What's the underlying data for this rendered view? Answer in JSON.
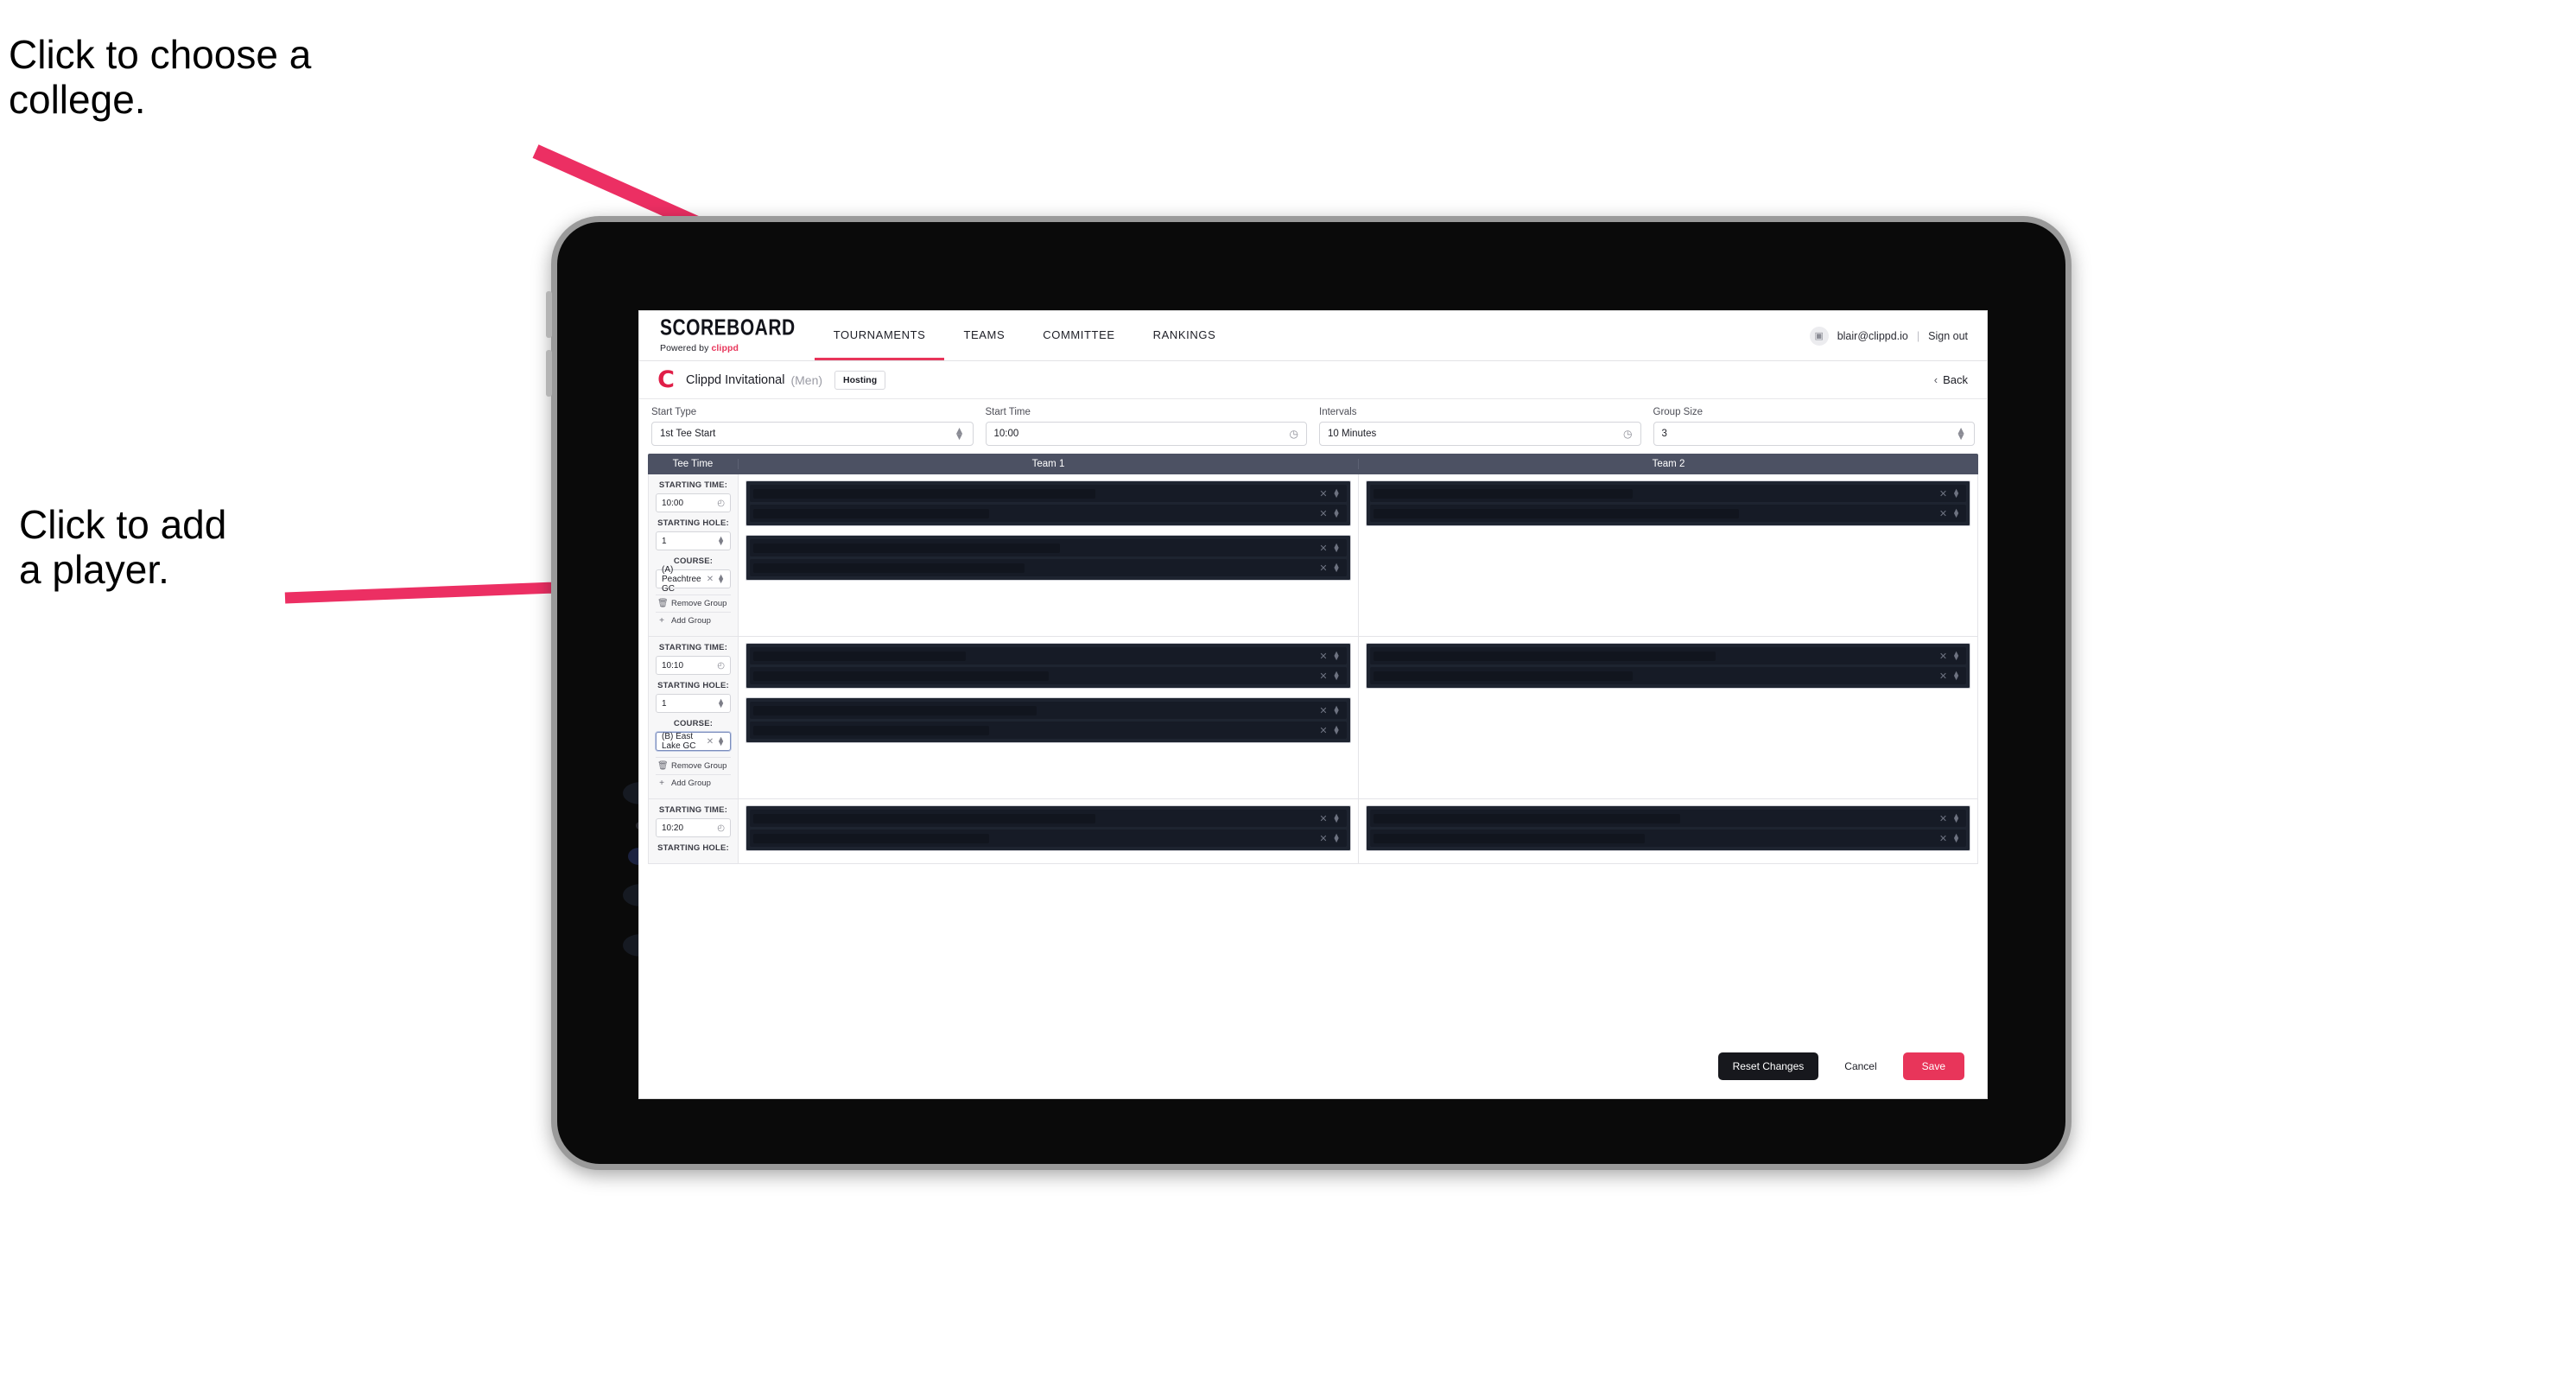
{
  "annotations": {
    "choose_college": "Click to choose a\ncollege.",
    "add_player": "Click to add\na player."
  },
  "colors": {
    "accent_pink": "#e8355a",
    "annotation_arrow": "#ec2f63",
    "table_header": "#4c5163",
    "player_block": "#1e2430",
    "dark_button": "#17181d"
  },
  "navbar": {
    "brand_title": "SCOREBOARD",
    "brand_sub_prefix": "Powered by ",
    "brand_sub_accent": "clippd",
    "links": [
      {
        "label": "TOURNAMENTS",
        "active": true
      },
      {
        "label": "TEAMS",
        "active": false
      },
      {
        "label": "COMMITTEE",
        "active": false
      },
      {
        "label": "RANKINGS",
        "active": false
      }
    ],
    "user_email": "blair@clippd.io",
    "separator": "|",
    "sign_out": "Sign out",
    "avatar_icon": "user-icon"
  },
  "tournament_header": {
    "logo_letter": "C",
    "name": "Clippd Invitational",
    "gender": "(Men)",
    "badge": "Hosting",
    "back_label": "Back",
    "back_icon": "chevron-left-icon"
  },
  "settings": [
    {
      "label": "Start Type",
      "value": "1st Tee Start",
      "adorn": "stepper-icon"
    },
    {
      "label": "Start Time",
      "value": "10:00",
      "adorn": "clock-icon"
    },
    {
      "label": "Intervals",
      "value": "10 Minutes",
      "adorn": "clock-icon"
    },
    {
      "label": "Group Size",
      "value": "3",
      "adorn": "stepper-icon"
    }
  ],
  "table": {
    "headers": {
      "tee_time": "Tee Time",
      "team1": "Team 1",
      "team2": "Team 2"
    },
    "field_labels": {
      "starting_time": "STARTING TIME:",
      "starting_hole": "STARTING HOLE:",
      "course": "COURSE:"
    },
    "group_actions": {
      "remove": "Remove Group",
      "add": "Add Group"
    },
    "action_icons": {
      "remove": "trash-icon",
      "add": "plus-icon"
    },
    "row_icons": {
      "clear": "close-icon",
      "select": "chevron-updown-icon"
    },
    "rows": [
      {
        "starting_time": "10:00",
        "starting_hole": "1",
        "course": "(A) Peachtree GC",
        "course_focused": false,
        "show_hole": true,
        "show_course": true,
        "show_actions": true,
        "team1_blocks": [
          2,
          2
        ],
        "team2_blocks": [
          2
        ]
      },
      {
        "starting_time": "10:10",
        "starting_hole": "1",
        "course": "(B) East Lake GC",
        "course_focused": true,
        "show_hole": true,
        "show_course": true,
        "show_actions": true,
        "team1_blocks": [
          2,
          2
        ],
        "team2_blocks": [
          2
        ]
      },
      {
        "starting_time": "10:20",
        "starting_hole": "",
        "course": "",
        "course_focused": false,
        "show_hole": false,
        "show_course": false,
        "show_actions": false,
        "team1_blocks": [
          2
        ],
        "team2_blocks": [
          2
        ]
      }
    ]
  },
  "footer": {
    "reset": "Reset Changes",
    "cancel": "Cancel",
    "save": "Save"
  }
}
